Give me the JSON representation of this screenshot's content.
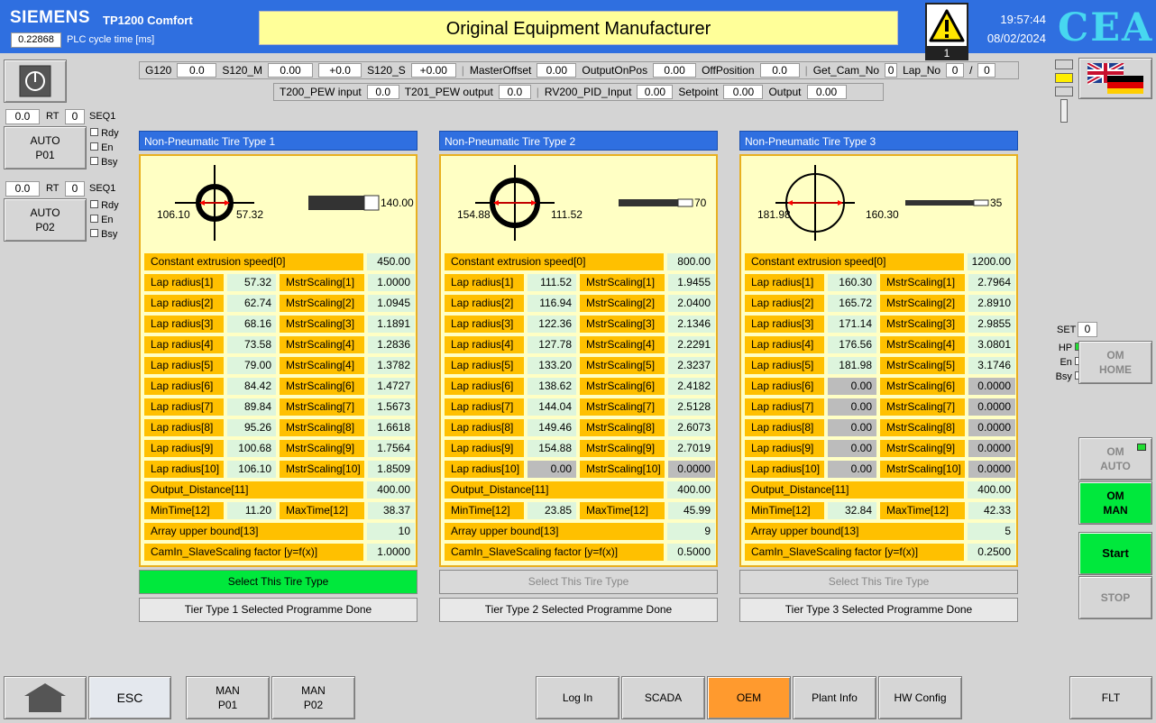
{
  "header": {
    "brand": "SIEMENS",
    "model": "TP1200 Comfort",
    "cycle_value": "0.22868",
    "cycle_label": "PLC cycle time [ms]",
    "title": "Original Equipment Manufacturer",
    "alarm_count": "1",
    "time": "19:57:44",
    "date": "08/02/2024",
    "logo": "CEA"
  },
  "strip": {
    "g120_label": "G120",
    "g120": "0.0",
    "s120m_label": "S120_M",
    "s120m": "0.00",
    "s120m2": "+0.0",
    "s120s_label": "S120_S",
    "s120s": "+0.00",
    "master_label": "MasterOffset",
    "master": "0.00",
    "outpos_label": "OutputOnPos",
    "outpos": "0.00",
    "offpos_label": "OffPosition",
    "offpos": "0.0",
    "getcam_label": "Get_Cam_No",
    "getcam": "0",
    "lapno_label": "Lap_No",
    "lapno": "0",
    "lapsep": "/",
    "lapno2": "0",
    "t200_label": "T200_PEW input",
    "t200": "0.0",
    "t201_label": "T201_PEW output",
    "t201": "0.0",
    "rv_label": "RV200_PID_Input",
    "rv": "0.00",
    "setp_label": "Setpoint",
    "setp": "0.00",
    "out_label": "Output",
    "out": "0.00"
  },
  "left": {
    "p1": {
      "val": "0.0",
      "rt": "RT",
      "rtval": "0",
      "seq": "SEQ1",
      "btn1": "AUTO",
      "btn2": "P01",
      "rdy": "Rdy",
      "en": "En",
      "bsy": "Bsy"
    },
    "p2": {
      "val": "0.0",
      "rt": "RT",
      "rtval": "0",
      "seq": "SEQ1",
      "btn1": "AUTO",
      "btn2": "P02",
      "rdy": "Rdy",
      "en": "En",
      "bsy": "Bsy"
    }
  },
  "right": {
    "set_label": "SET",
    "set_val": "0",
    "hp": "HP",
    "en": "En",
    "bsy": "Bsy",
    "om_home1": "OM",
    "om_home2": "HOME",
    "om_auto1": "OM",
    "om_auto2": "AUTO",
    "om_man1": "OM",
    "om_man2": "MAN",
    "start": "Start",
    "stop": "STOP"
  },
  "labels": {
    "const": "Constant extrusion speed[0]",
    "output": "Output_Distance[11]",
    "min": "MinTime[12]",
    "max": "MaxTime[12]",
    "array": "Array upper bound[13]",
    "camin": "CamIn_SlaveScaling factor [y=f(x)]",
    "select": "Select This Tire Type"
  },
  "panels": [
    {
      "title": "Non-Pneumatic Tire Type 1",
      "d1": "106.10",
      "d2": "57.32",
      "width": "140.00",
      "const": "450.00",
      "rows": [
        [
          "Lap radius[1]",
          "57.32",
          "MstrScaling[1]",
          "1.0000"
        ],
        [
          "Lap radius[2]",
          "62.74",
          "MstrScaling[2]",
          "1.0945"
        ],
        [
          "Lap radius[3]",
          "68.16",
          "MstrScaling[3]",
          "1.1891"
        ],
        [
          "Lap radius[4]",
          "73.58",
          "MstrScaling[4]",
          "1.2836"
        ],
        [
          "Lap radius[5]",
          "79.00",
          "MstrScaling[4]",
          "1.3782"
        ],
        [
          "Lap radius[6]",
          "84.42",
          "MstrScaling[6]",
          "1.4727"
        ],
        [
          "Lap radius[7]",
          "89.84",
          "MstrScaling[7]",
          "1.5673"
        ],
        [
          "Lap radius[8]",
          "95.26",
          "MstrScaling[8]",
          "1.6618"
        ],
        [
          "Lap radius[9]",
          "100.68",
          "MstrScaling[9]",
          "1.7564"
        ],
        [
          "Lap radius[10]",
          "106.10",
          "MstrScaling[10]",
          "1.8509"
        ]
      ],
      "output": "400.00",
      "min": "11.20",
      "max": "38.37",
      "array": "10",
      "camin": "1.0000",
      "done": "Tier Type 1 Selected Programme Done",
      "active": true,
      "empty": 0
    },
    {
      "title": "Non-Pneumatic Tire Type 2",
      "d1": "154.88",
      "d2": "111.52",
      "width": "70",
      "const": "800.00",
      "rows": [
        [
          "Lap radius[1]",
          "111.52",
          "MstrScaling[1]",
          "1.9455"
        ],
        [
          "Lap radius[2]",
          "116.94",
          "MstrScaling[2]",
          "2.0400"
        ],
        [
          "Lap radius[3]",
          "122.36",
          "MstrScaling[3]",
          "2.1346"
        ],
        [
          "Lap radius[4]",
          "127.78",
          "MstrScaling[4]",
          "2.2291"
        ],
        [
          "Lap radius[5]",
          "133.20",
          "MstrScaling[5]",
          "2.3237"
        ],
        [
          "Lap radius[6]",
          "138.62",
          "MstrScaling[6]",
          "2.4182"
        ],
        [
          "Lap radius[7]",
          "144.04",
          "MstrScaling[7]",
          "2.5128"
        ],
        [
          "Lap radius[8]",
          "149.46",
          "MstrScaling[8]",
          "2.6073"
        ],
        [
          "Lap radius[9]",
          "154.88",
          "MstrScaling[9]",
          "2.7019"
        ],
        [
          "Lap radius[10]",
          "0.00",
          "MstrScaling[10]",
          "0.0000"
        ]
      ],
      "output": "400.00",
      "min": "23.85",
      "max": "45.99",
      "array": "9",
      "camin": "0.5000",
      "done": "Tier Type 2 Selected Programme Done",
      "active": false,
      "empty": 1
    },
    {
      "title": "Non-Pneumatic Tire Type 3",
      "d1": "181.98",
      "d2": "160.30",
      "width": "35",
      "const": "1200.00",
      "rows": [
        [
          "Lap radius[1]",
          "160.30",
          "MstrScaling[1]",
          "2.7964"
        ],
        [
          "Lap radius[2]",
          "165.72",
          "MstrScaling[2]",
          "2.8910"
        ],
        [
          "Lap radius[3]",
          "171.14",
          "MstrScaling[3]",
          "2.9855"
        ],
        [
          "Lap radius[4]",
          "176.56",
          "MstrScaling[4]",
          "3.0801"
        ],
        [
          "Lap radius[5]",
          "181.98",
          "MstrScaling[5]",
          "3.1746"
        ],
        [
          "Lap radius[6]",
          "0.00",
          "MstrScaling[6]",
          "0.0000"
        ],
        [
          "Lap radius[7]",
          "0.00",
          "MstrScaling[7]",
          "0.0000"
        ],
        [
          "Lap radius[8]",
          "0.00",
          "MstrScaling[8]",
          "0.0000"
        ],
        [
          "Lap radius[9]",
          "0.00",
          "MstrScaling[9]",
          "0.0000"
        ],
        [
          "Lap radius[10]",
          "0.00",
          "MstrScaling[10]",
          "0.0000"
        ]
      ],
      "output": "400.00",
      "min": "32.84",
      "max": "42.33",
      "array": "5",
      "camin": "0.2500",
      "done": "Tier Type 3 Selected Programme Done",
      "active": false,
      "empty": 5
    }
  ],
  "footer": {
    "esc": "ESC",
    "man1a": "MAN",
    "man1b": "P01",
    "man2a": "MAN",
    "man2b": "P02",
    "login": "Log In",
    "scada": "SCADA",
    "oem": "OEM",
    "plant": "Plant Info",
    "hw": "HW Config",
    "flt": "FLT"
  },
  "colors": {
    "header": "#2f6fe0",
    "title_bg": "#ffff99",
    "orange": "#ffc000",
    "value_green": "#ddf5dd",
    "active_green": "#00e83c",
    "oem": "#ff9a2e"
  },
  "icons": {
    "power": "power-icon",
    "alarm": "warning-icon",
    "flag": "uk-germany-flag-icon",
    "home": "home-icon"
  }
}
